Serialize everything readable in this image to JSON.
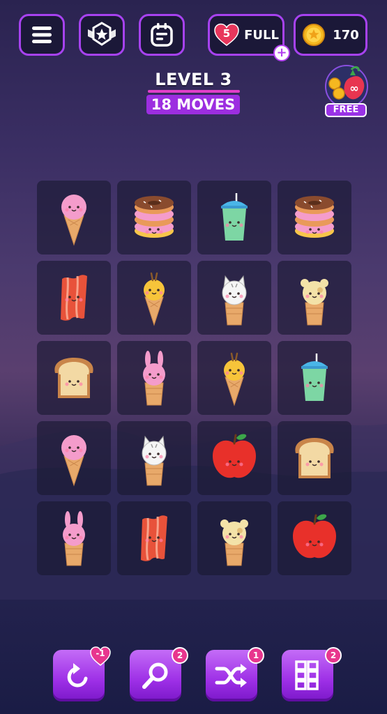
{
  "header": {
    "lives_count": "5",
    "lives_status": "FULL",
    "coins": "170",
    "add_lives_symbol": "+",
    "icons": [
      "menu-icon",
      "rank-badge-icon",
      "calendar-icon",
      "heart-icon",
      "coin-icon"
    ]
  },
  "level": {
    "title": "LEVEL 3",
    "moves": "18 MOVES"
  },
  "free_offer": {
    "label": "FREE",
    "icon": "strawberry-coins-icon"
  },
  "board": {
    "rows": 5,
    "cols": 4,
    "tiles": [
      [
        "pink-ice-cream",
        "donut-stack",
        "boba-drink",
        "donut-stack"
      ],
      [
        "bacon",
        "yellow-ice-cream",
        "cat-ice-cream",
        "bear-ice-cream"
      ],
      [
        "toast",
        "bunny-ice-cream",
        "yellow-ice-cream",
        "boba-drink"
      ],
      [
        "pink-ice-cream",
        "cat-ice-cream",
        "apple",
        "toast"
      ],
      [
        "bunny-ice-cream",
        "bacon",
        "bear-ice-cream",
        "apple"
      ]
    ]
  },
  "boosters": [
    {
      "name": "undo",
      "icon": "undo-icon",
      "badge": "-1",
      "badge_style": "heart"
    },
    {
      "name": "magnify",
      "icon": "magnifier-icon",
      "badge": "2"
    },
    {
      "name": "shuffle",
      "icon": "shuffle-icon",
      "badge": "1"
    },
    {
      "name": "grid",
      "icon": "grid-icon",
      "badge": "2"
    }
  ],
  "colors": {
    "accent_purple": "#a742f0",
    "moves_bg": "#9c2ee0",
    "badge_pink": "#e8368e",
    "tile_bg": "#1b1a34"
  }
}
